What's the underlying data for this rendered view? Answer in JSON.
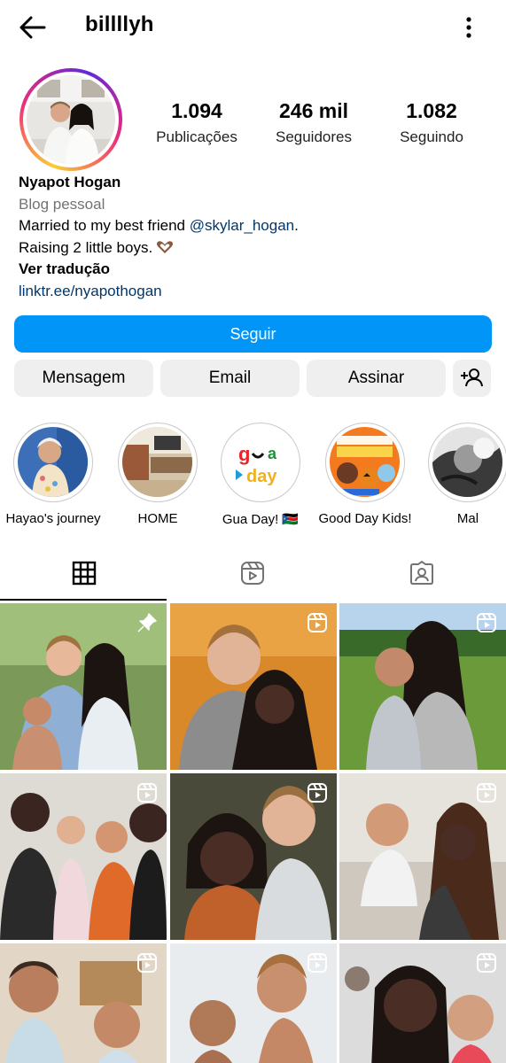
{
  "header": {
    "username": "billllyh",
    "back_icon": "arrow-left-icon",
    "menu_icon": "more-vertical-icon"
  },
  "profile": {
    "stats": [
      {
        "value": "1.094",
        "label": "Publicações"
      },
      {
        "value": "246 mil",
        "label": "Seguidores"
      },
      {
        "value": "1.082",
        "label": "Seguindo"
      }
    ],
    "name": "Nyapot Hogan",
    "category": "Blog pessoal",
    "bio_line1_prefix": "Married to my best friend ",
    "bio_mention": "@skylar_hogan",
    "bio_line1_suffix": ".",
    "bio_line2": "Raising 2 little boys.",
    "bio_emoji": "heart-hands-icon",
    "translate": "Ver tradução",
    "link": "linktr.ee/nyapothogan"
  },
  "actions": {
    "follow": "Seguir",
    "message": "Mensagem",
    "email": "Email",
    "subscribe": "Assinar",
    "suggest_icon": "add-person-icon"
  },
  "highlights": [
    {
      "label": "Hayao's journey"
    },
    {
      "label": "HOME"
    },
    {
      "label": "Gua Day! 🇸🇸"
    },
    {
      "label": "Good Day Kids!"
    },
    {
      "label": "Mal"
    }
  ],
  "tabs": [
    "grid-icon",
    "reels-icon",
    "tagged-icon"
  ],
  "colors": {
    "accent": "#0095f6",
    "link": "#00376b",
    "button_gray": "#efefef"
  },
  "posts": [
    {
      "badge": "pin-icon"
    },
    {
      "badge": "reel-icon"
    },
    {
      "badge": "reel-icon"
    },
    {
      "badge": "reel-icon"
    },
    {
      "badge": "reel-icon"
    },
    {
      "badge": "reel-icon"
    },
    {
      "badge": "reel-icon"
    },
    {
      "badge": "reel-icon"
    },
    {
      "badge": "reel-icon"
    }
  ]
}
